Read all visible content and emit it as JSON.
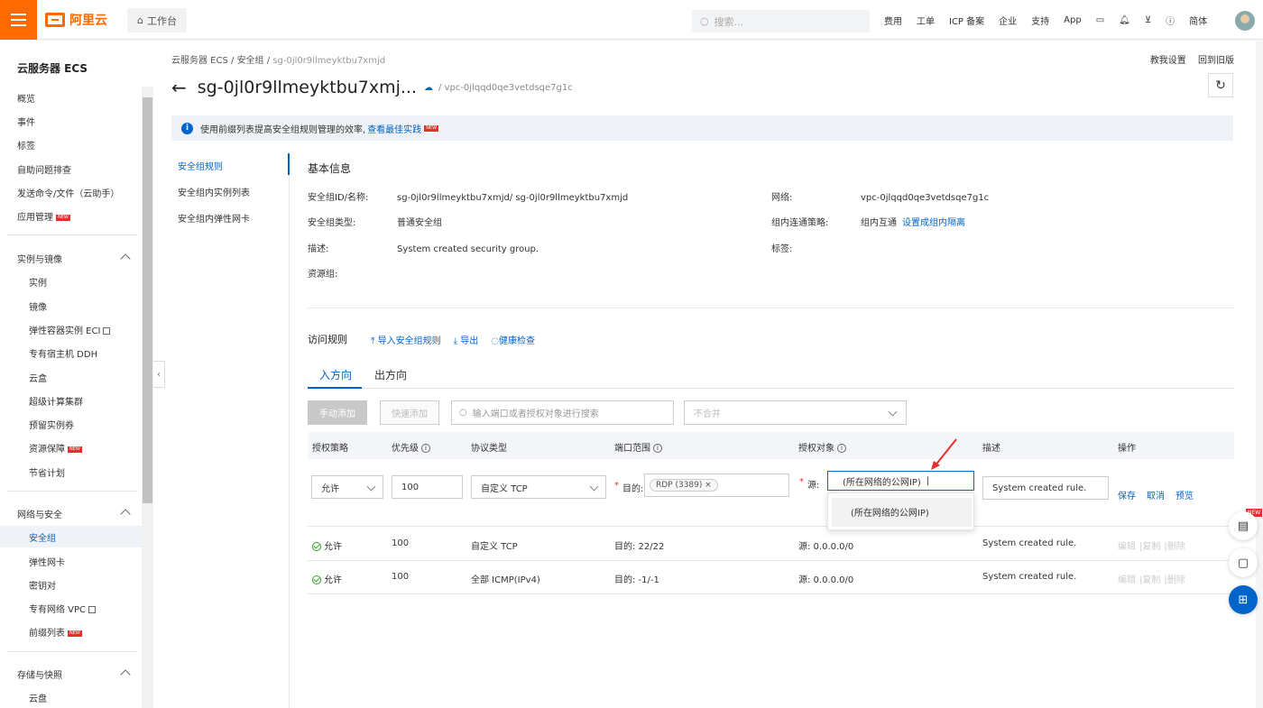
{
  "topbar": {
    "logo_text": "阿里云",
    "workbench": "工作台",
    "search_placeholder": "搜索...",
    "nav": [
      "费用",
      "工单",
      "ICP 备案",
      "企业",
      "支持",
      "App"
    ],
    "lang": "简体",
    "accent": "#ff6a00"
  },
  "sidebar": {
    "title": "云服务器 ECS",
    "top_items": [
      "概览",
      "事件",
      "标签",
      "自助问题排查",
      "发送命令/文件（云助手）",
      "应用管理"
    ],
    "group1": {
      "label": "实例与镜像",
      "items": [
        "实例",
        "镜像",
        "弹性容器实例 ECI",
        "专有宿主机 DDH",
        "云盒",
        "超级计算集群",
        "预留实例券",
        "资源保障",
        "节省计划"
      ]
    },
    "group2": {
      "label": "网络与安全",
      "items": [
        "安全组",
        "弹性网卡",
        "密钥对",
        "专有网络 VPC",
        "前缀列表"
      ]
    },
    "group3": {
      "label": "存储与快照",
      "items": [
        "云盘"
      ]
    },
    "new_badge": "NEW"
  },
  "breadcrumb": {
    "a": "云服务器 ECS",
    "b": "安全组",
    "c": "sg-0jl0r9llmeyktbu7xmjd"
  },
  "toplinks": {
    "a": "教我设置",
    "b": "回到旧版"
  },
  "title": {
    "name": "sg-0jl0r9llmeyktbu7xmj...",
    "vpc": "/ vpc-0jlqqd0qe3vetdsqe7g1c"
  },
  "notice": {
    "text": "使用前缀列表提高安全组规则管理的效率,",
    "link": "查看最佳实践"
  },
  "subnav": [
    "安全组规则",
    "安全组内实例列表",
    "安全组内弹性网卡"
  ],
  "basic": {
    "title": "基本信息",
    "id_label": "安全组ID/名称:",
    "id_value": "sg-0jl0r9llmeyktbu7xmjd/ sg-0jl0r9llmeyktbu7xmjd",
    "type_label": "安全组类型:",
    "type_value": "普通安全组",
    "desc_label": "描述:",
    "desc_value": "System created security group.",
    "rg_label": "资源组:",
    "net_label": "网络:",
    "net_value": "vpc-0jlqqd0qe3vetdsqe7g1c",
    "policy_label": "组内连通策略:",
    "policy_value": "组内互通",
    "policy_link": "设置成组内隔离",
    "tag_label": "标签:"
  },
  "access": {
    "title": "访问规则",
    "import": "导入安全组规则",
    "export": "导出",
    "health": "健康检查",
    "tab_in": "入方向",
    "tab_out": "出方向",
    "btn_manual": "手动添加",
    "btn_quick": "快速添加",
    "search_placeholder": "输入端口或者授权对象进行搜索",
    "merge": "不合并"
  },
  "table": {
    "headers": [
      "授权策略",
      "优先级",
      "协议类型",
      "端口范围",
      "授权对象",
      "描述",
      "操作"
    ],
    "edit": {
      "policy": "允许",
      "priority": "100",
      "protocol": "自定义 TCP",
      "port_label": "目的:",
      "port_tag": "RDP (3389)",
      "src_label": "源:",
      "src_value": "(所在网络的公网IP)",
      "dropdown_option": "(所在网络的公网IP)",
      "desc": "System created rule.",
      "save": "保存",
      "cancel": "取消",
      "preview": "预览"
    },
    "rows": [
      {
        "policy": "允许",
        "priority": "100",
        "protocol": "自定义 TCP",
        "port": "目的: 22/22",
        "src": "源: 0.0.0.0/0",
        "desc": "System created rule.",
        "edit": "编辑",
        "copy": "复制",
        "del": "删除"
      },
      {
        "policy": "允许",
        "priority": "100",
        "protocol": "全部 ICMP(IPv4)",
        "port": "目的: -1/-1",
        "src": "源: 0.0.0.0/0",
        "desc": "System created rule.",
        "edit": "编辑",
        "copy": "复制",
        "del": "删除"
      }
    ]
  },
  "float_new": "NEW"
}
